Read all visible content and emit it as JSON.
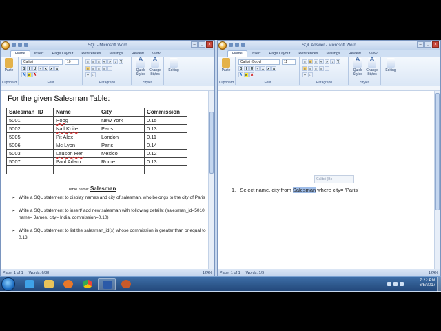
{
  "left_window": {
    "title": "SQL - Microsoft Word",
    "tabs": [
      "Home",
      "Insert",
      "Page Layout",
      "References",
      "Mailings",
      "Review",
      "View"
    ],
    "ribbon": {
      "paste": "Paste",
      "font_name": "Calibri",
      "font_size": "10",
      "quick_styles": "Quick Styles",
      "change_styles": "Change Styles",
      "editing": "Editing",
      "groups": [
        "Clipboard",
        "Font",
        "Paragraph",
        "Styles"
      ]
    },
    "document": {
      "heading": "For the given Salesman Table:",
      "table_headers": [
        "Salesman_ID",
        "Name",
        "City",
        "Commission"
      ],
      "table_rows": [
        [
          "5001",
          "Hoog",
          "New York",
          "0.15"
        ],
        [
          "5002",
          "Nail Knite",
          "Paris",
          "0.13"
        ],
        [
          "5005",
          "Pit Alex",
          "London",
          "0.11"
        ],
        [
          "5006",
          "Mc Lyon",
          "Paris",
          "0.14"
        ],
        [
          "5003",
          "Lauson Hen",
          "Mexico",
          "0.12"
        ],
        [
          "5007",
          "Paul Adam",
          "Rome",
          "0.13"
        ]
      ],
      "caption_prefix": "Table name:",
      "caption_name": "Salesman",
      "bullets": [
        "Write a SQL statement to display names and city of salesman, who belongs to the city of Paris",
        "Write a SQL statement to insert/ add new salesman with following details: (salesman_id=5010, name= James, city= India, commission=0.10)",
        "Write a SQL statement to list the salesman_id(s) whose commission is greater than or equal to 0.13"
      ]
    },
    "status": {
      "page": "Page: 1 of 1",
      "words": "Words: 6/88",
      "zoom": "124%"
    }
  },
  "right_window": {
    "title": "SQL Answer - Microsoft Word",
    "tabs": [
      "Home",
      "Insert",
      "Page Layout",
      "References",
      "Mailings",
      "Review",
      "View"
    ],
    "ribbon": {
      "paste": "Paste",
      "font_name": "Calibri (Body)",
      "font_size": "11",
      "quick_styles": "Quick Styles",
      "change_styles": "Change Styles",
      "editing": "Editing",
      "groups": [
        "Clipboard",
        "Font",
        "Paragraph",
        "Styles"
      ]
    },
    "document": {
      "mini_toolbar_font": "Calibri (Bo",
      "line_number": "1.",
      "line_before": "Select name,  city from ",
      "line_selected": "Salesman",
      "line_after": " where city= 'Paris'"
    },
    "status": {
      "page": "Page: 1 of 1",
      "words": "Words: 1/9",
      "zoom": "124%"
    }
  },
  "taskbar": {
    "time": "7:22 PM",
    "date": "6/5/2017"
  }
}
